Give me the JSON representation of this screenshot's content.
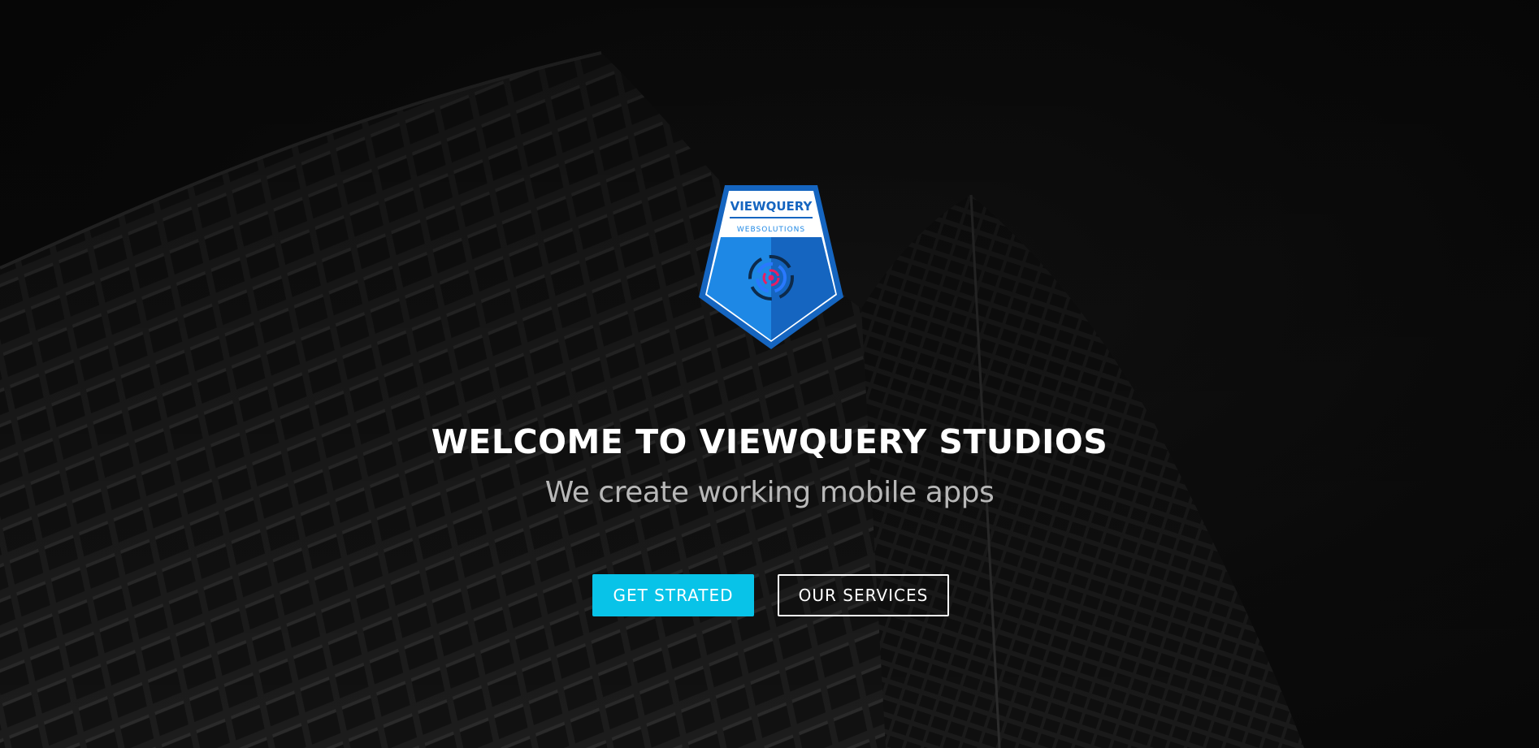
{
  "logo": {
    "brand": "VIEWQUERY",
    "tagline": "WEBSOLUTIONS"
  },
  "hero": {
    "headline": "WELCOME TO VIEWQUERY STUDIOS",
    "subline": "We create working mobile apps"
  },
  "buttons": {
    "primary_label": "GET STRATED",
    "secondary_label": "OUR SERVICES"
  },
  "colors": {
    "accent": "#08c3e8",
    "logo_blue": "#1e88e5",
    "logo_dark_blue": "#1565c0",
    "background": "#0a0a0a"
  }
}
